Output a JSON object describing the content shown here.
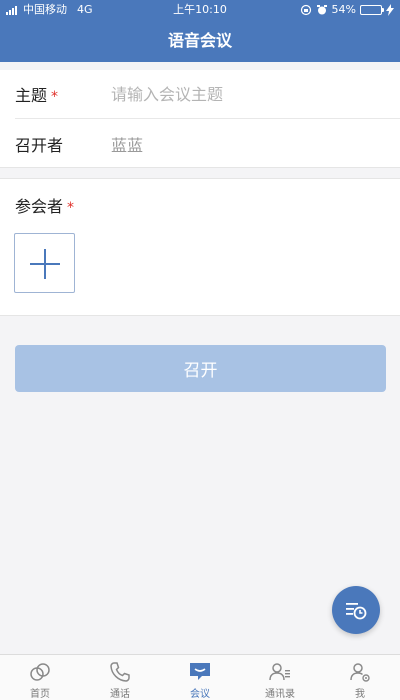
{
  "status_bar": {
    "carrier": "中国移动",
    "network": "4G",
    "time": "上午10:10",
    "battery": "54%",
    "battery_level": 0.54
  },
  "nav": {
    "title": "语音会议"
  },
  "form": {
    "topic_label": "主题",
    "topic_required": "*",
    "topic_placeholder": "请输入会议主题",
    "host_label": "召开者",
    "host_value": "蓝蓝"
  },
  "participants": {
    "label": "参会者",
    "required": "*"
  },
  "actions": {
    "open_label": "召开"
  },
  "tabs": [
    {
      "label": "首页",
      "icon": "home-icon",
      "active": false
    },
    {
      "label": "通话",
      "icon": "phone-icon",
      "active": false
    },
    {
      "label": "会议",
      "icon": "meeting-icon",
      "active": true
    },
    {
      "label": "通讯录",
      "icon": "contacts-icon",
      "active": false
    },
    {
      "label": "我",
      "icon": "profile-settings-icon",
      "active": false
    }
  ],
  "colors": {
    "primary": "#4a78bb",
    "button_disabled": "#a8c2e4",
    "required": "#e0302a"
  }
}
